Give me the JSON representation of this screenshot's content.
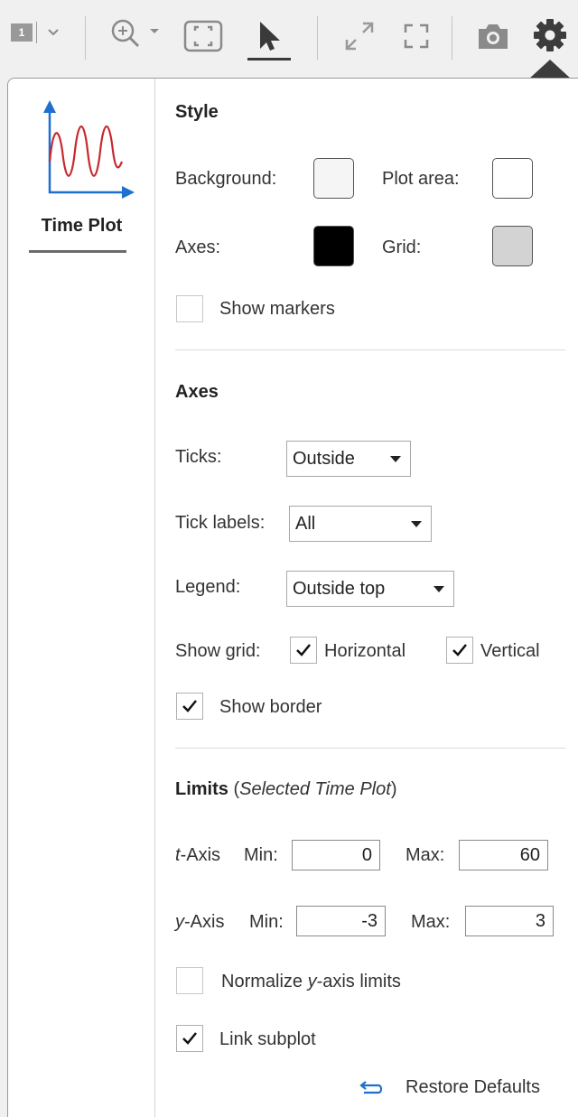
{
  "toolbar": {
    "page_badge": "1",
    "items": [
      "layout-selector",
      "zoom",
      "fit-to-view",
      "select",
      "expand",
      "fullscreen",
      "snapshot",
      "settings"
    ]
  },
  "sidebar": {
    "thumbnail_label": "Time Plot",
    "colors": {
      "axis": "#1e6fd0",
      "trace": "#c8282d"
    }
  },
  "style": {
    "heading": "Style",
    "background_label": "Background:",
    "background_color": "#f5f5f5",
    "plot_area_label": "Plot area:",
    "plot_area_color": "#ffffff",
    "axes_label": "Axes:",
    "axes_color": "#000000",
    "grid_label": "Grid:",
    "grid_color": "#d3d3d3",
    "show_markers_label": "Show markers",
    "show_markers_checked": false
  },
  "axes": {
    "heading": "Axes",
    "ticks_label": "Ticks:",
    "ticks_value": "Outside",
    "tick_labels_label": "Tick labels:",
    "tick_labels_value": "All",
    "legend_label": "Legend:",
    "legend_value": "Outside top",
    "show_grid_label": "Show grid:",
    "horizontal_label": "Horizontal",
    "horizontal_checked": true,
    "vertical_label": "Vertical",
    "vertical_checked": true,
    "show_border_label": "Show border",
    "show_border_checked": true
  },
  "limits": {
    "heading": "Limits",
    "heading_suffix_open": " (",
    "heading_suffix_italic": "Selected Time Plot",
    "heading_suffix_close": ")",
    "t_axis_var": "t",
    "t_axis_rest": "-Axis",
    "y_axis_var": "y",
    "y_axis_rest": "-Axis",
    "min_label": "Min:",
    "max_label": "Max:",
    "t_min": "0",
    "t_max": "60",
    "y_min": "-3",
    "y_max": "3",
    "normalize_prefix": "Normalize ",
    "normalize_var": "y",
    "normalize_suffix": "-axis limits",
    "normalize_checked": false,
    "link_subplot_label": "Link subplot",
    "link_subplot_checked": true
  },
  "footer": {
    "restore_label": "Restore Defaults",
    "restore_color": "#1e6fd0"
  }
}
